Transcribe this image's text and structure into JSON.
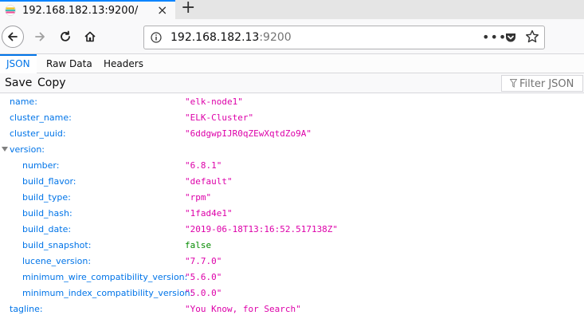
{
  "browser": {
    "tab_title": "192.168.182.13:9200/",
    "tab_close": "×",
    "new_tab": "+",
    "url_host": "192.168.182.13",
    "url_port": ":9200",
    "page_actions": "•••"
  },
  "viewer": {
    "tabs": [
      "JSON",
      "Raw Data",
      "Headers"
    ],
    "save_label": "Save",
    "copy_label": "Copy",
    "filter_placeholder": "Filter JSON"
  },
  "json": {
    "top": [
      {
        "key": "name:",
        "value": "\"elk-node1\""
      },
      {
        "key": "cluster_name:",
        "value": "\"ELK-Cluster\""
      },
      {
        "key": "cluster_uuid:",
        "value": "\"6ddgwpIJR0qZEwXqtdZo9A\""
      }
    ],
    "version_key": "version:",
    "version": [
      {
        "key": "number:",
        "value": "\"6.8.1\""
      },
      {
        "key": "build_flavor:",
        "value": "\"default\""
      },
      {
        "key": "build_type:",
        "value": "\"rpm\""
      },
      {
        "key": "build_hash:",
        "value": "\"1fad4e1\""
      },
      {
        "key": "build_date:",
        "value": "\"2019-06-18T13:16:52.517138Z\""
      },
      {
        "key": "build_snapshot:",
        "value": "false"
      },
      {
        "key": "lucene_version:",
        "value": "\"7.7.0\""
      },
      {
        "key": "minimum_wire_compatibility_version:",
        "value": "\"5.6.0\""
      },
      {
        "key": "minimum_index_compatibility_version:",
        "value": "\"5.0.0\""
      }
    ],
    "tagline_key": "tagline:",
    "tagline_value": "\"You Know, for Search\""
  },
  "colors": {
    "key": "#0074e8",
    "string": "#dd00a9",
    "boolean": "#058b00",
    "accent": "#0a84ff"
  }
}
